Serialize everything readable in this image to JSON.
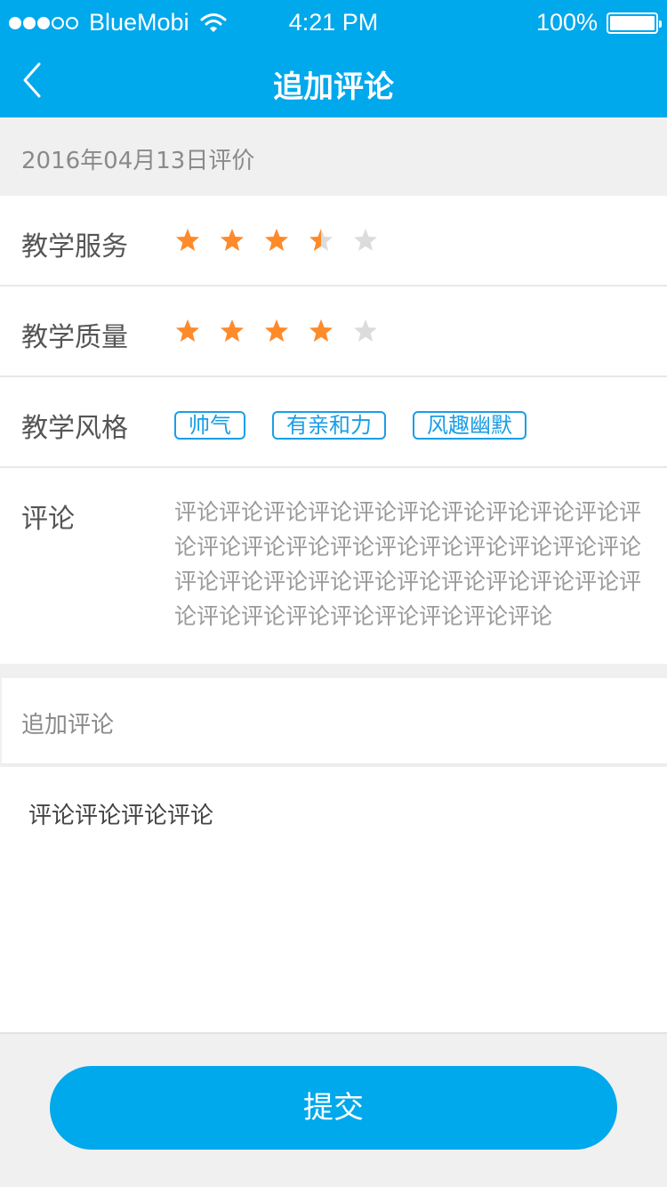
{
  "status_bar": {
    "carrier": "BlueMobi",
    "time": "4:21 PM",
    "battery": "100%",
    "signal_bars": 3,
    "signal_total": 5
  },
  "nav": {
    "title": "追加评论",
    "back_icon": "chevron-left-icon"
  },
  "review": {
    "date": "2016年04月13日评价",
    "service": {
      "label": "教学服务",
      "rating": 3.5,
      "max": 5
    },
    "quality": {
      "label": "教学质量",
      "rating": 4,
      "max": 5
    },
    "style": {
      "label": "教学风格",
      "tags": [
        "帅气",
        "有亲和力",
        "风趣幽默"
      ]
    },
    "comment": {
      "label": "评论",
      "text": "评论评论评论评论评论评论评论评论评论评论评论评论评论评论评论评论评论评论评论评论评论评论评论评论评论评论评论评论评论评论评论评论评论评论评论评论评论评论评论评论"
    }
  },
  "append": {
    "label": "追加评论",
    "value": "评论评论评论评论"
  },
  "submit_label": "提交",
  "colors": {
    "primary": "#00a8ec",
    "star_on": "#ff8a2a",
    "star_off": "#dcdcdc",
    "tag": "#1a9ee6"
  }
}
